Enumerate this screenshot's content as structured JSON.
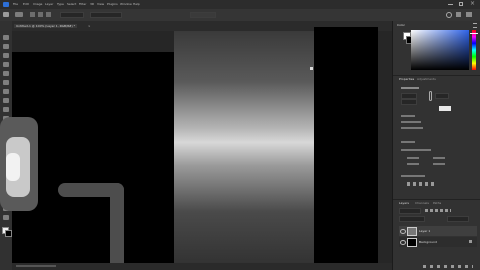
{
  "app": {
    "document_tab": "Untitled-1 @ 100% (Layer 1, RGB/8#) *",
    "menu_items": [
      "File",
      "Edit",
      "Image",
      "Layer",
      "Type",
      "Select",
      "Filter",
      "3D",
      "View",
      "Plugins",
      "Window",
      "Help"
    ]
  },
  "options_bar": {
    "mode_field": "",
    "right_field": ""
  },
  "panels": {
    "color_tab": "Color",
    "properties_tabs": [
      "Properties",
      "Adjustments"
    ],
    "layers_tabs": [
      "Layers",
      "Channels",
      "Paths"
    ],
    "layers": [
      {
        "name": "Layer 1"
      },
      {
        "name": "Background"
      }
    ]
  },
  "colors": {
    "accent": "#4a8cf7",
    "panel_bg": "#323232",
    "canvas_bg": "#262626"
  }
}
